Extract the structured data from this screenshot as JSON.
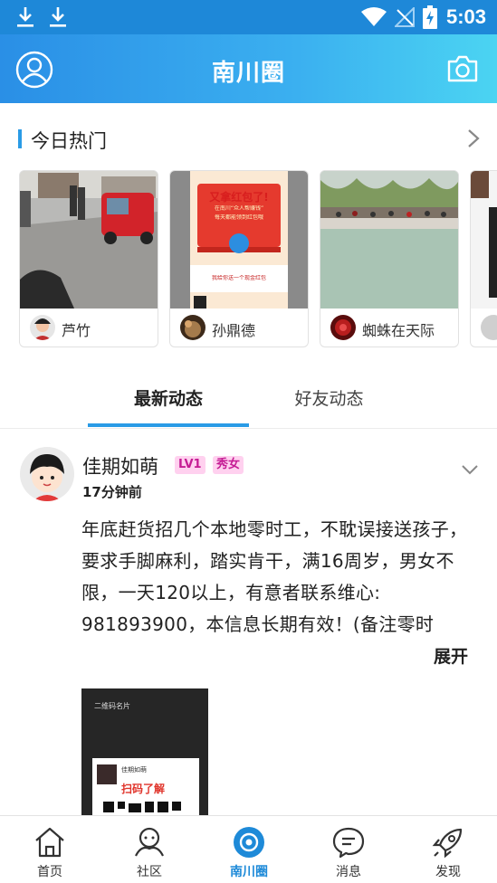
{
  "status_bar": {
    "time": "5:03"
  },
  "header": {
    "title": "南川圈"
  },
  "hot": {
    "title": "今日热门",
    "cards": [
      {
        "user": "芦竹"
      },
      {
        "user": "孙鼎德",
        "poster_title": "又拿红包了!",
        "poster_line1": "在南川“众人帮赚钱”",
        "poster_line2": "每天都能领到红包哦",
        "poster_footer": "我给你送一个现金红包"
      },
      {
        "user": "蜘蛛在天际"
      },
      {
        "user": ""
      }
    ]
  },
  "tabs": {
    "latest": "最新动态",
    "friends": "好友动态"
  },
  "post": {
    "name": "佳期如萌",
    "level_badge": "LV1",
    "tag_badge": "秀女",
    "time": "17分钟前",
    "text": "年底赶货招几个本地零时工，不耽误接送孩子，要求手脚麻利，踏实肯干，满16周岁，男女不限，一天120以上，有意者联系维心: 981893900，本信息长期有效！(备注零时",
    "expand": "展开",
    "image": {
      "top_label": "二维码名片",
      "card_name": "佳期如萌",
      "scan_text": "扫码了解"
    }
  },
  "bottom_nav": {
    "items": [
      {
        "label": "首页"
      },
      {
        "label": "社区"
      },
      {
        "label": "南川圈"
      },
      {
        "label": "消息"
      },
      {
        "label": "发现"
      }
    ]
  },
  "colors": {
    "accent": "#2a9be6",
    "header_start": "#2a8fe6",
    "header_end": "#4bd4f2",
    "badge_bg": "#ffd1ef",
    "badge_text": "#c51c94"
  }
}
